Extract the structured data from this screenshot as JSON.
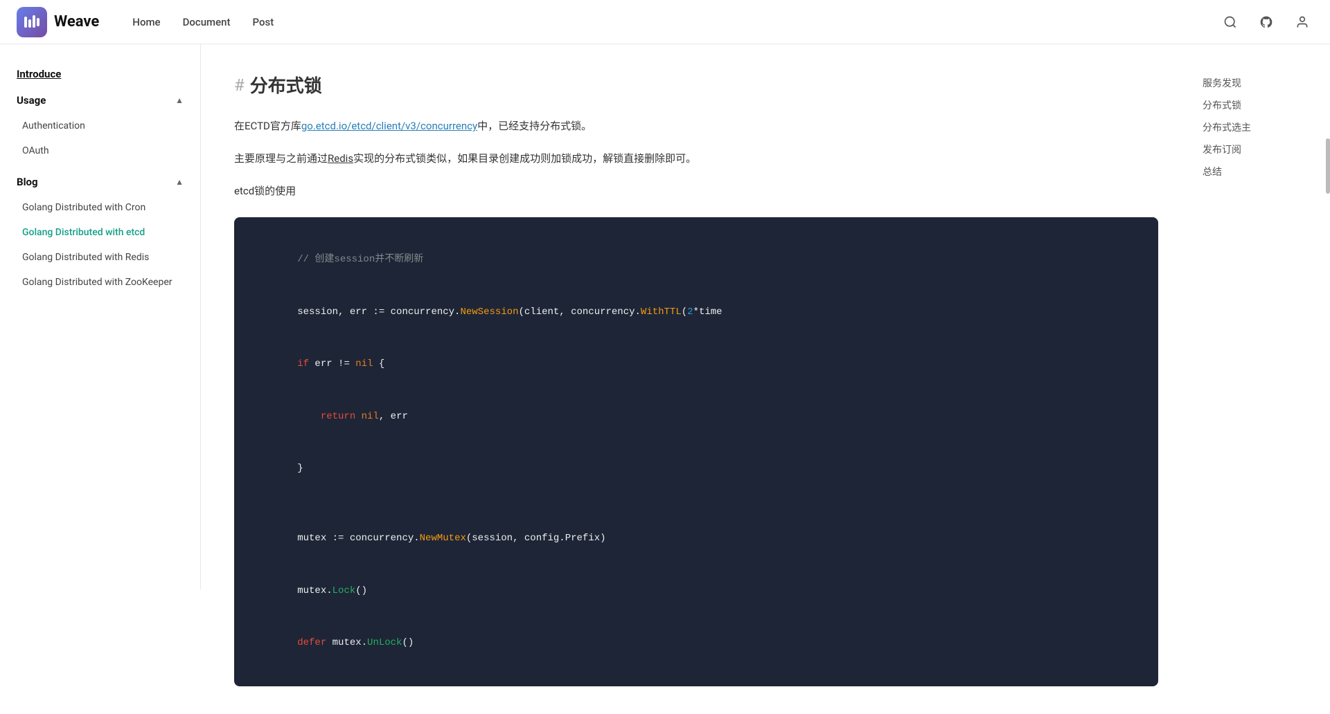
{
  "header": {
    "logo_text": "Weave",
    "nav": [
      {
        "label": "Home",
        "href": "#"
      },
      {
        "label": "Document",
        "href": "#"
      },
      {
        "label": "Post",
        "href": "#"
      }
    ],
    "icons": [
      "search",
      "github",
      "user"
    ]
  },
  "sidebar": {
    "top_items": [
      {
        "label": "Introduce",
        "collapsible": false
      }
    ],
    "sections": [
      {
        "label": "Usage",
        "expanded": true,
        "items": [
          {
            "label": "Authentication",
            "active": false
          },
          {
            "label": "OAuth",
            "active": false
          }
        ]
      },
      {
        "label": "Blog",
        "expanded": true,
        "items": [
          {
            "label": "Golang Distributed with Cron",
            "active": false
          },
          {
            "label": "Golang Distributed with etcd",
            "active": true
          },
          {
            "label": "Golang Distributed with Redis",
            "active": false
          },
          {
            "label": "Golang Distributed with ZooKeeper",
            "active": false
          }
        ]
      }
    ]
  },
  "toc": {
    "items": [
      {
        "label": "服务发现",
        "active": false
      },
      {
        "label": "分布式锁",
        "active": false
      },
      {
        "label": "分布式选主",
        "active": false
      },
      {
        "label": "发布订阅",
        "active": false
      },
      {
        "label": "总结",
        "active": false
      }
    ]
  },
  "main": {
    "title": "分布式锁",
    "hash": "#",
    "paragraphs": [
      "在ECTD官方库go.etcd.io/etcd/client/v3/concurrency中，已经支持分布式锁。",
      "主要原理与之前通过Redis实现的分布式锁类似，如果目录创建成功则加锁成功，解锁直接删除即可。",
      "etcd锁的使用"
    ],
    "code": {
      "lines": [
        {
          "type": "comment",
          "text": "// 创建session并不断刷新"
        },
        {
          "type": "code",
          "text": "session, err := concurrency.NewSession(client, concurrency.WithTTL(2*time"
        },
        {
          "type": "code",
          "text": "if err != nil {"
        },
        {
          "type": "code",
          "text": "    return nil, err"
        },
        {
          "type": "code",
          "text": "}"
        },
        {
          "type": "blank",
          "text": ""
        },
        {
          "type": "code",
          "text": "mutex := concurrency.NewMutex(session, config.Prefix)"
        },
        {
          "type": "code",
          "text": "mutex.Lock()"
        },
        {
          "type": "code",
          "text": "defer mutex.UnLock()"
        }
      ]
    }
  }
}
